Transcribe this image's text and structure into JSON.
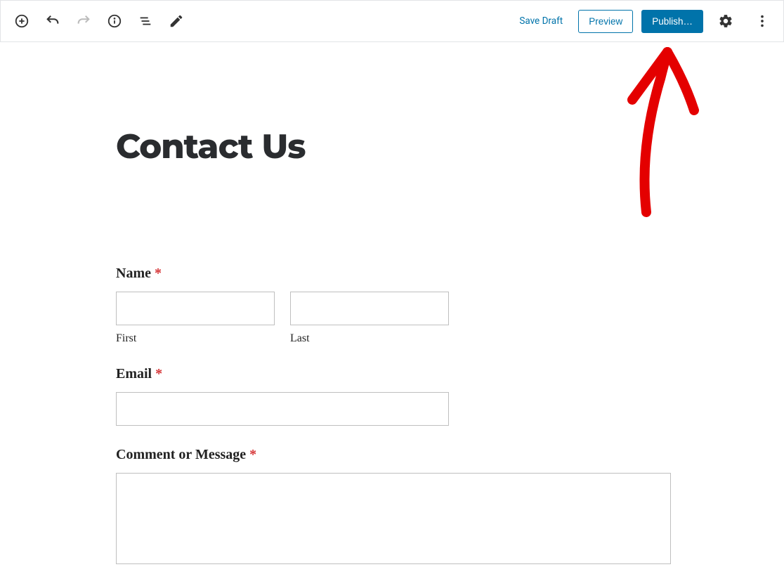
{
  "toolbar": {
    "save_draft": "Save Draft",
    "preview": "Preview",
    "publish": "Publish…"
  },
  "page": {
    "title": "Contact Us"
  },
  "form": {
    "name": {
      "label": "Name",
      "first_sub": "First",
      "last_sub": "Last"
    },
    "email": {
      "label": "Email"
    },
    "message": {
      "label": "Comment or Message"
    },
    "required_marker": "*"
  }
}
